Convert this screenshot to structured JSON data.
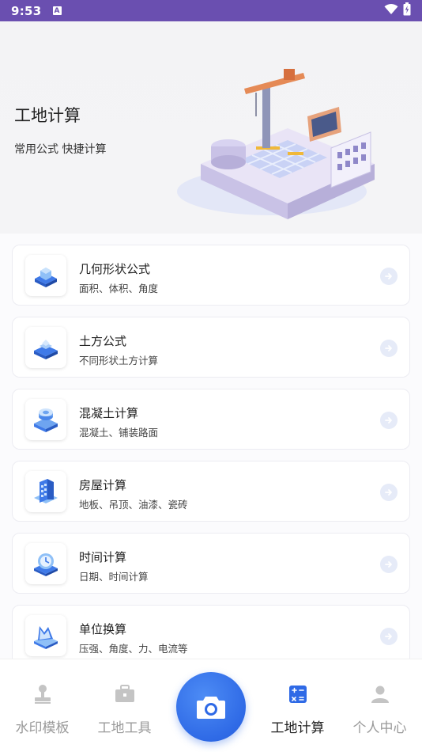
{
  "status_bar": {
    "time": "9:53",
    "notification_letter": "A"
  },
  "hero": {
    "title": "工地计算",
    "subtitle": "常用公式 快捷计算"
  },
  "items": [
    {
      "title": "几何形状公式",
      "subtitle": "面积、体积、角度",
      "icon": "geometry-cube-icon"
    },
    {
      "title": "土方公式",
      "subtitle": "不同形状土方计算",
      "icon": "earthwork-icon"
    },
    {
      "title": "混凝土计算",
      "subtitle": "混凝土、铺装路面",
      "icon": "concrete-icon"
    },
    {
      "title": "房屋计算",
      "subtitle": "地板、吊顶、油漆、瓷砖",
      "icon": "building-icon"
    },
    {
      "title": "时间计算",
      "subtitle": "日期、时间计算",
      "icon": "clock-icon"
    },
    {
      "title": "单位换算",
      "subtitle": "压强、角度、力、电流等",
      "icon": "unit-convert-icon"
    }
  ],
  "nav": {
    "items": [
      {
        "label": "水印模板",
        "icon": "watermark-template-icon",
        "active": false
      },
      {
        "label": "工地工具",
        "icon": "toolbox-icon",
        "active": false
      },
      {
        "label": "工地计算",
        "icon": "calculator-icon",
        "active": true
      },
      {
        "label": "个人中心",
        "icon": "person-icon",
        "active": false
      }
    ],
    "camera_icon": "camera-icon"
  },
  "colors": {
    "status_bar": "#6a4fb0",
    "accent": "#2f6ae6",
    "arrow_bg": "#e6ebf8"
  }
}
